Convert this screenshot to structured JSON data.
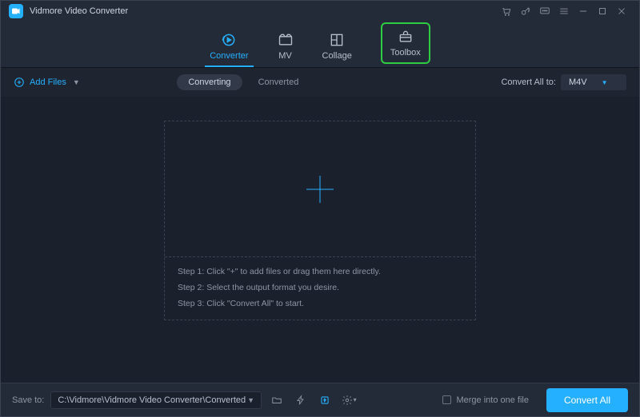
{
  "app": {
    "title": "Vidmore Video Converter"
  },
  "nav": {
    "items": [
      {
        "label": "Converter"
      },
      {
        "label": "MV"
      },
      {
        "label": "Collage"
      },
      {
        "label": "Toolbox"
      }
    ]
  },
  "toolbar": {
    "add_files": "Add Files",
    "converting": "Converting",
    "converted": "Converted",
    "convert_all_to": "Convert All to:",
    "format": "M4V"
  },
  "dropzone": {
    "step1": "Step 1: Click \"+\" to add files or drag them here directly.",
    "step2": "Step 2: Select the output format you desire.",
    "step3": "Step 3: Click \"Convert All\" to start."
  },
  "footer": {
    "save_to": "Save to:",
    "path": "C:\\Vidmore\\Vidmore Video Converter\\Converted",
    "merge": "Merge into one file",
    "convert_all": "Convert All"
  }
}
